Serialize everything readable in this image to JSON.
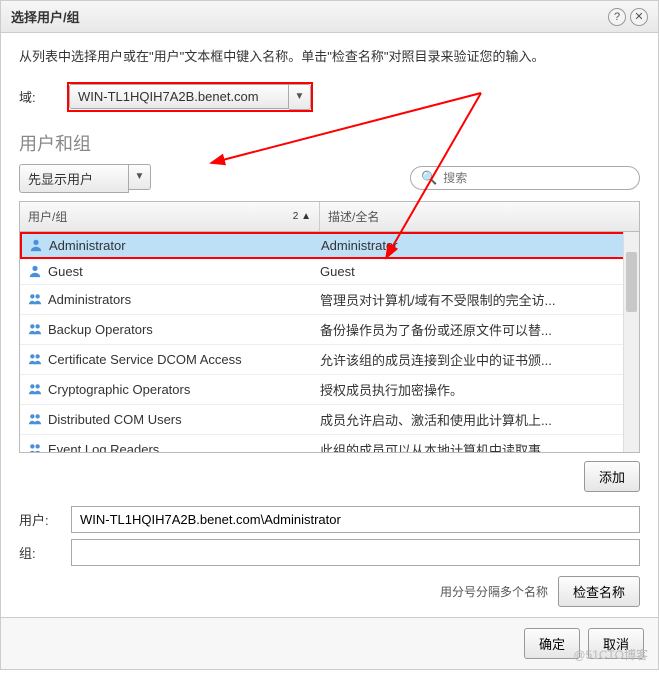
{
  "titlebar": {
    "title": "选择用户/组"
  },
  "instruction": "从列表中选择用户或在\"用户\"文本框中键入名称。单击\"检查名称\"对照目录来验证您的输入。",
  "domain": {
    "label": "域:",
    "value": "WIN-TL1HQIH7A2B.benet.com"
  },
  "section_title": "用户和组",
  "filter": {
    "value": "先显示用户"
  },
  "search": {
    "placeholder": "搜索"
  },
  "table": {
    "header": {
      "name": "用户/组",
      "sort_indicator": "2 ▲",
      "desc": "描述/全名"
    },
    "rows": [
      {
        "name": "Administrator",
        "desc": "Administrator",
        "type": "user",
        "selected": true
      },
      {
        "name": "Guest",
        "desc": "Guest",
        "type": "user",
        "selected": false
      },
      {
        "name": "Administrators",
        "desc": "管理员对计算机/域有不受限制的完全访...",
        "type": "group",
        "selected": false
      },
      {
        "name": "Backup Operators",
        "desc": "备份操作员为了备份或还原文件可以替...",
        "type": "group",
        "selected": false
      },
      {
        "name": "Certificate Service DCOM Access",
        "desc": "允许该组的成员连接到企业中的证书颁...",
        "type": "group",
        "selected": false
      },
      {
        "name": "Cryptographic Operators",
        "desc": "授权成员执行加密操作。",
        "type": "group",
        "selected": false
      },
      {
        "name": "Distributed COM Users",
        "desc": "成员允许启动、激活和使用此计算机上...",
        "type": "group",
        "selected": false
      },
      {
        "name": "Event Log Readers",
        "desc": "此组的成员可以从本地计算机中读取事...",
        "type": "group",
        "selected": false
      }
    ]
  },
  "add_button": "添加",
  "user_field": {
    "label": "用户:",
    "value": "WIN-TL1HQIH7A2B.benet.com\\Administrator"
  },
  "group_field": {
    "label": "组:",
    "value": ""
  },
  "hint": "用分号分隔多个名称",
  "check_button": "检查名称",
  "footer": {
    "ok": "确定",
    "cancel": "取消"
  },
  "watermark": "@51CTO博客"
}
